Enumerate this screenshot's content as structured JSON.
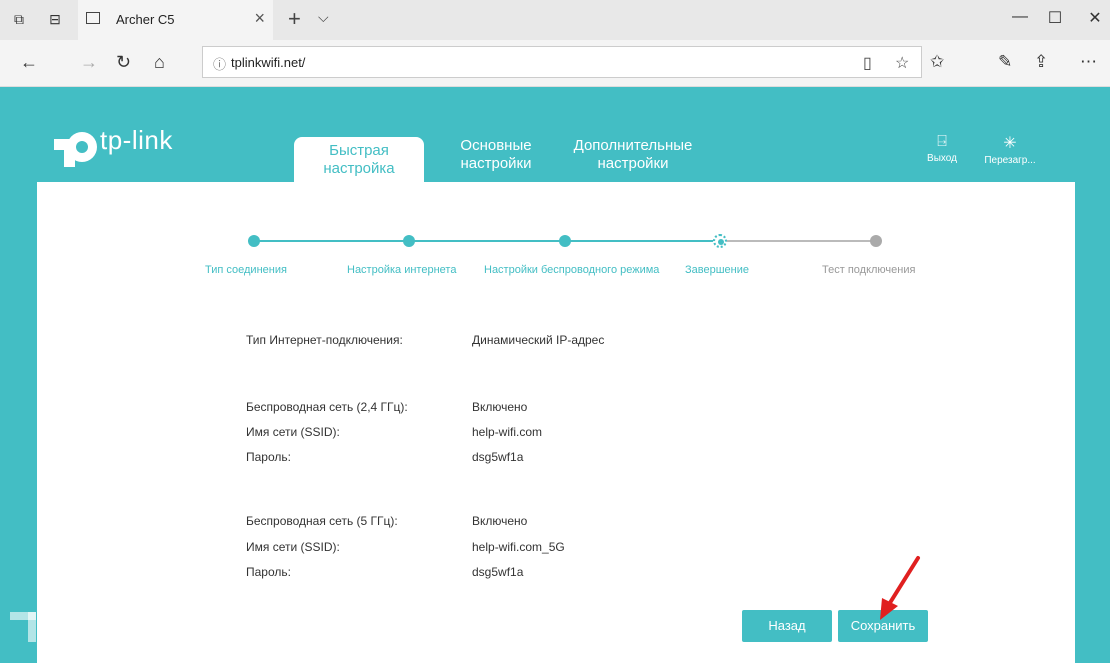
{
  "browser": {
    "tab_title": "Archer C5",
    "url": "tplinkwifi.net/"
  },
  "header": {
    "logo_text": "tp-link",
    "tabs": [
      {
        "line1": "Быстрая",
        "line2": "настройка"
      },
      {
        "line1": "Основные",
        "line2": "настройки"
      },
      {
        "line1": "Дополнительные",
        "line2": "настройки"
      }
    ],
    "logout_label": "Выход",
    "reboot_label": "Перезагр..."
  },
  "steps": [
    {
      "label": "Тип соединения",
      "state": "done"
    },
    {
      "label": "Настройка интернета",
      "state": "done"
    },
    {
      "label": "Настройки беспроводного режима",
      "state": "done"
    },
    {
      "label": "Завершение",
      "state": "current"
    },
    {
      "label": "Тест подключения",
      "state": "pending"
    }
  ],
  "summary": {
    "connection_type_label": "Тип Интернет-подключения:",
    "connection_type_value": "Динамический IP-адрес",
    "wifi24": {
      "label": "Беспроводная сеть (2,4 ГГц):",
      "value": "Включено",
      "ssid_label": "Имя сети (SSID):",
      "ssid_value": "help-wifi.com",
      "password_label": "Пароль:",
      "password_value": "dsg5wf1a"
    },
    "wifi5": {
      "label": "Беспроводная сеть (5 ГГц):",
      "value": "Включено",
      "ssid_label": "Имя сети (SSID):",
      "ssid_value": "help-wifi.com_5G",
      "password_label": "Пароль:",
      "password_value": "dsg5wf1a"
    }
  },
  "buttons": {
    "back": "Назад",
    "save": "Сохранить"
  },
  "colors": {
    "accent": "#43bec4",
    "arrow": "#e02020"
  }
}
